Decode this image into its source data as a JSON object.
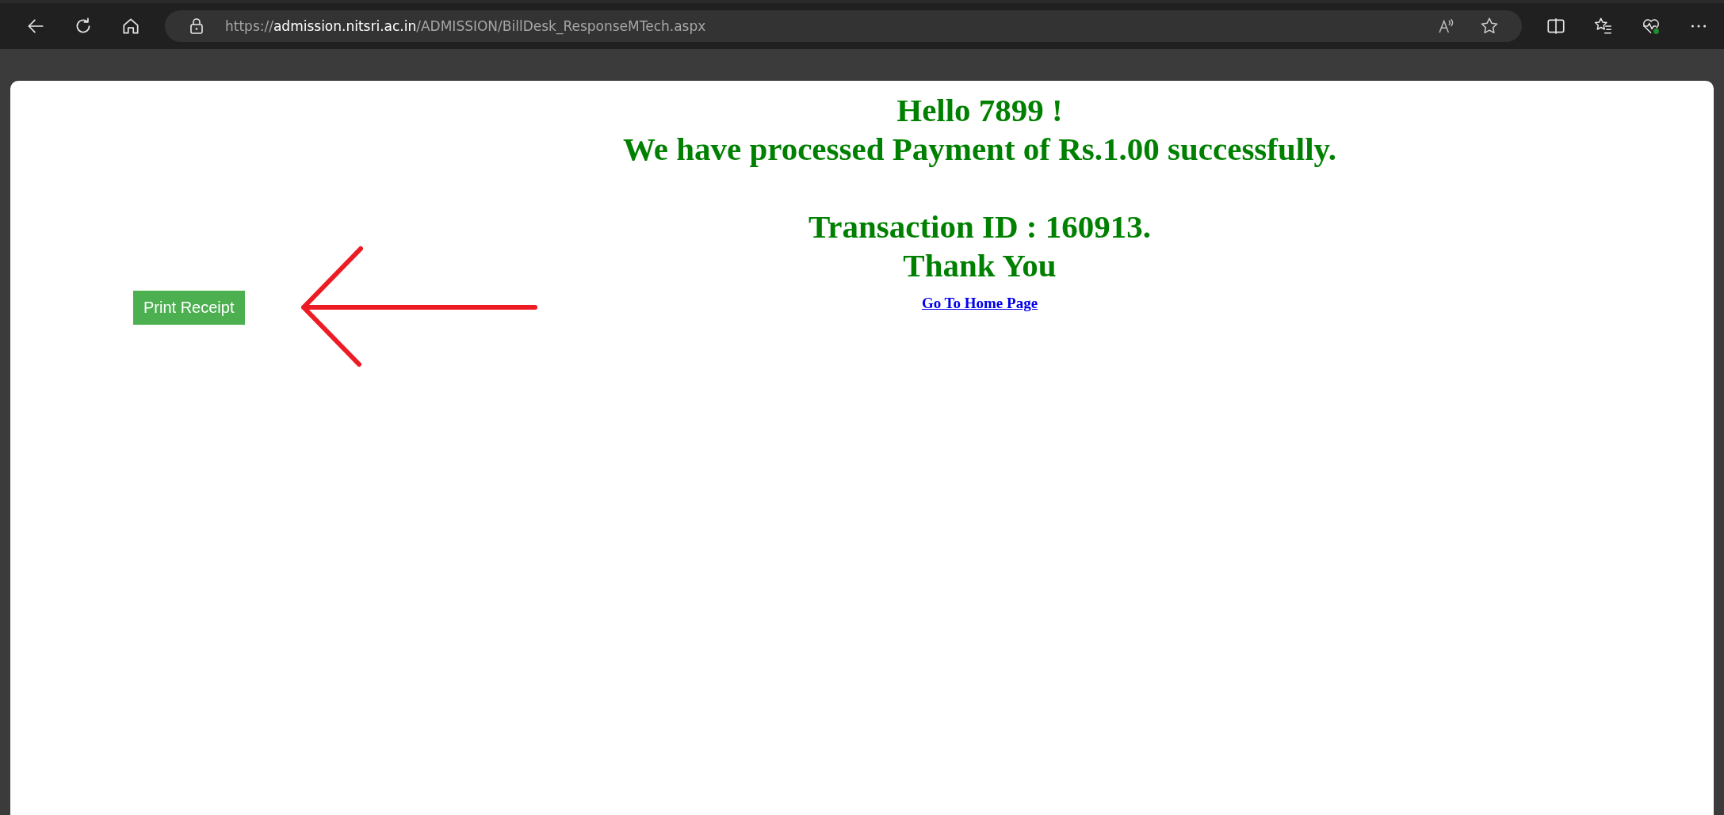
{
  "browser": {
    "url": "https://**admission.nitsri.ac.in**/ADMISSION/BillDesk_ResponseMTech.aspx"
  },
  "page": {
    "greeting": "Hello 7899 !",
    "message": "We have processed Payment of Rs.1.00 successfully.",
    "transaction": "Transaction ID : 160913.",
    "thanks": "Thank You",
    "home_link": "Go To Home Page",
    "print_button": "Print Receipt"
  }
}
